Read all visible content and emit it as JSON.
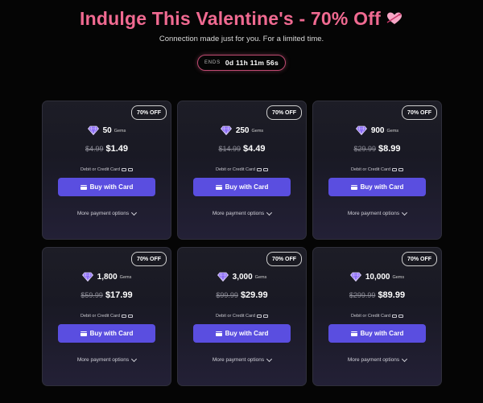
{
  "hero": {
    "title": "Indulge This Valentine's - 70% Off",
    "subtitle": "Connection made just for you. For a limited time."
  },
  "timer": {
    "label": "ENDS",
    "value": "0d 11h 11m 56s"
  },
  "offers": [
    {
      "badge": "70% OFF",
      "amount": "50",
      "unit": "Gems",
      "old_price": "$4.99",
      "new_price": "$1.49",
      "method": "Debit or Credit Card",
      "button": "Buy with Card",
      "more": "More payment options"
    },
    {
      "badge": "70% OFF",
      "amount": "250",
      "unit": "Gems",
      "old_price": "$14.99",
      "new_price": "$4.49",
      "method": "Debit or Credit Card",
      "button": "Buy with Card",
      "more": "More payment options"
    },
    {
      "badge": "70% OFF",
      "amount": "900",
      "unit": "Gems",
      "old_price": "$29.99",
      "new_price": "$8.99",
      "method": "Debit or Credit Card",
      "button": "Buy with Card",
      "more": "More payment options"
    },
    {
      "badge": "70% OFF",
      "amount": "1,800",
      "unit": "Gems",
      "old_price": "$59.99",
      "new_price": "$17.99",
      "method": "Debit or Credit Card",
      "button": "Buy with Card",
      "more": "More payment options"
    },
    {
      "badge": "70% OFF",
      "amount": "3,000",
      "unit": "Gems",
      "old_price": "$99.99",
      "new_price": "$29.99",
      "method": "Debit or Credit Card",
      "button": "Buy with Card",
      "more": "More payment options"
    },
    {
      "badge": "70% OFF",
      "amount": "10,000",
      "unit": "Gems",
      "old_price": "$299.99",
      "new_price": "$89.99",
      "method": "Debit or Credit Card",
      "button": "Buy with Card",
      "more": "More payment options"
    }
  ],
  "icons": {
    "heart": "heart-arrow-icon",
    "gem": "gem-icon",
    "card": "credit-card-icon",
    "chevron": "chevron-down-icon"
  },
  "colors": {
    "accent": "#f06a91",
    "button": "#5a4ee0",
    "gem": "#8b6cf6"
  }
}
